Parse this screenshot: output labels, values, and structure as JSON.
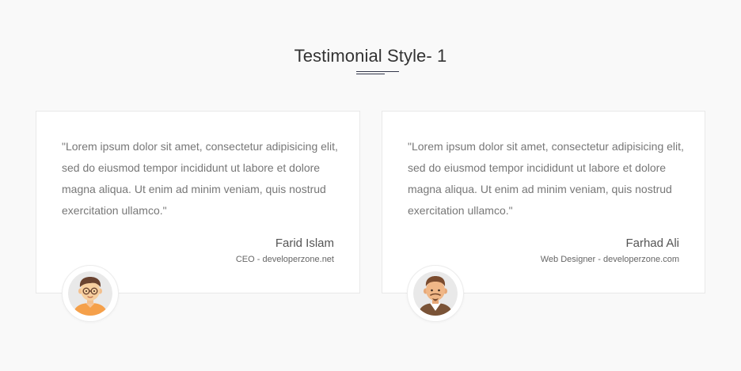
{
  "section": {
    "title": "Testimonial Style- 1"
  },
  "testimonials": [
    {
      "quote": "\"Lorem ipsum dolor sit amet, consectetur adipisicing elit, sed do eiusmod tempor incididunt ut labore et dolore magna aliqua. Ut enim ad minim veniam, quis nostrud exercitation ullamco.\"",
      "name": "Farid Islam",
      "role": "CEO - developerzone.net",
      "avatar_icon": "avatar-boy-glasses-icon"
    },
    {
      "quote": "\"Lorem ipsum dolor sit amet, consectetur adipisicing elit, sed do eiusmod tempor incididunt ut labore et dolore magna aliqua. Ut enim ad minim veniam, quis nostrud exercitation ullamco.\"",
      "name": "Farhad Ali",
      "role": "Web Designer - developerzone.com",
      "avatar_icon": "avatar-man-beard-icon"
    }
  ],
  "colors": {
    "background": "#f9f9f9",
    "card": "#ffffff",
    "accent_line": "#33374a",
    "text_muted": "#777777"
  }
}
